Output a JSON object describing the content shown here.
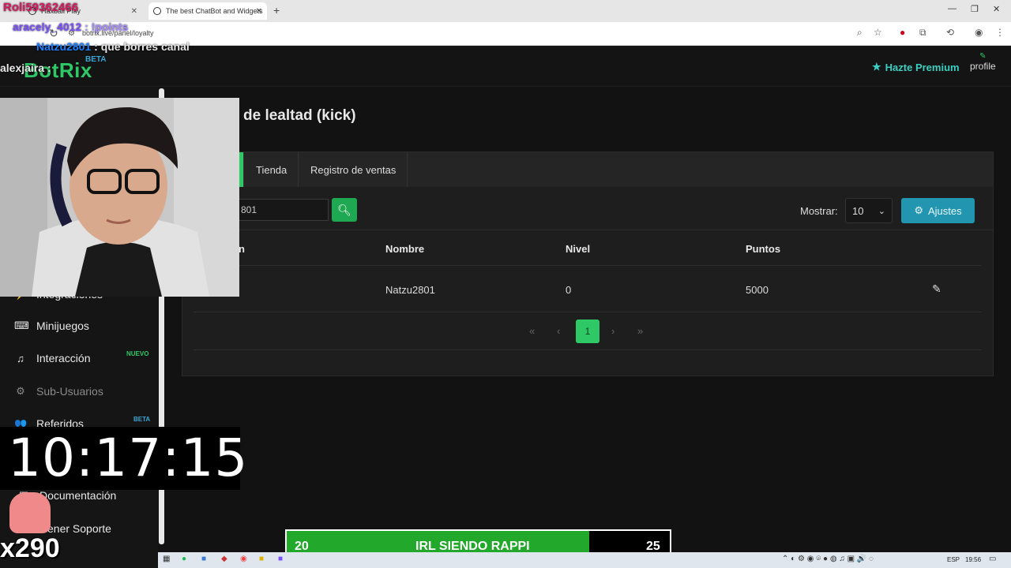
{
  "browser": {
    "tabs": [
      {
        "label": "Haxball Play",
        "active": false
      },
      {
        "label": "The best ChatBot and Widgets",
        "active": true
      }
    ],
    "url": "botrix.live/panel/loyalty"
  },
  "app": {
    "logo": "BotRix",
    "logo_badge": "BETA",
    "premium_label": "Hazte Premium",
    "profile_label": "profile"
  },
  "sidebar": {
    "items": [
      {
        "label": "Integraciones",
        "icon": "plug-icon",
        "dim": false
      },
      {
        "label": "Minijuegos",
        "icon": "gamepad-icon",
        "dim": false
      },
      {
        "label": "Interacción",
        "icon": "music-icon",
        "dim": false,
        "badge": "NUEVO",
        "badge_color": "#2ec866"
      },
      {
        "label": "Sub-Usuarios",
        "icon": "gear-icon",
        "dim": true
      },
      {
        "label": "Referidos",
        "icon": "users-icon",
        "dim": false,
        "badge": "BETA",
        "badge_color": "#3aa6d6"
      },
      {
        "label": "Documentación",
        "icon": "book-icon",
        "dim": false
      },
      {
        "label": "ener Soporte",
        "icon": "help-icon",
        "dim": false
      }
    ]
  },
  "main": {
    "title": "de lealtad (kick)",
    "tabs": [
      "Tienda",
      "Registro de ventas"
    ],
    "search_value": "801",
    "show_label": "Mostrar:",
    "show_value": "10",
    "settings_label": "Ajustes",
    "table": {
      "headers": [
        "n",
        "Nombre",
        "Nivel",
        "Puntos"
      ],
      "rows": [
        {
          "nombre": "Natzu2801",
          "nivel": "0",
          "puntos": "5000"
        }
      ]
    },
    "pagination": {
      "current": "1",
      "first": "«",
      "prev": "‹",
      "next": "›",
      "last": "»"
    }
  },
  "overlay": {
    "chat": [
      {
        "user": "Roli59362466",
        "message": ""
      },
      {
        "user": "aracely_4012",
        "message": ": !points"
      },
      {
        "user": "Natzu2801",
        "message": ": que borres canal"
      },
      {
        "user": "alexjaira",
        "message": ":"
      }
    ],
    "clock": "10:17:15",
    "multiplier": "x290",
    "goal": {
      "left": "20",
      "label": "IRL SIENDO RAPPI",
      "right": "25",
      "progress": 0.79
    }
  },
  "taskbar": {
    "lang": "ESP",
    "time": "19:56"
  }
}
